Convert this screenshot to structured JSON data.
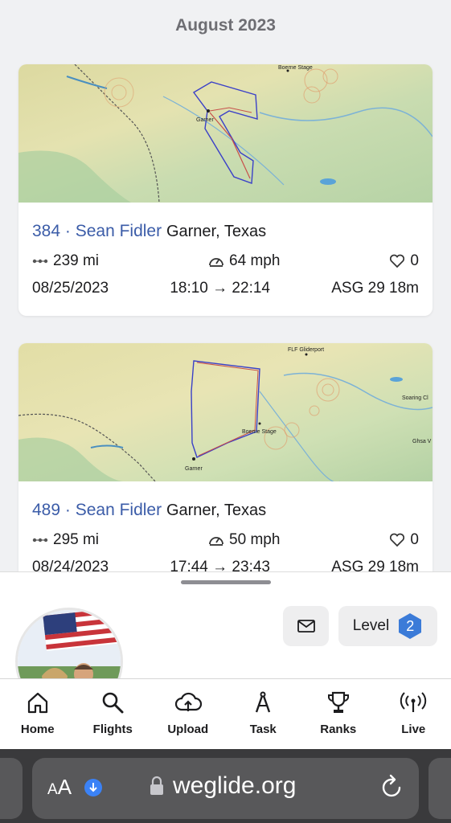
{
  "month_header": "August 2023",
  "flights": [
    {
      "id_pilot": "384 · Sean Fidler",
      "location": "Garner, Texas",
      "distance": "239 mi",
      "speed": "64 mph",
      "likes": "0",
      "date": "08/25/2023",
      "time_range": "18:10 → 22:14",
      "aircraft": "ASG 29 18m",
      "map_labels": {
        "start": "Garner",
        "tp1": "Boerne Stage"
      }
    },
    {
      "id_pilot": "489 · Sean Fidler",
      "location": "Garner, Texas",
      "distance": "295 mi",
      "speed": "50 mph",
      "likes": "0",
      "date": "08/24/2023",
      "time_range": "17:44 → 23:43",
      "aircraft": "ASG 29 18m",
      "map_labels": {
        "start": "Garner",
        "tp1": "Boerne Stage",
        "tp2": "FLF Gliderport",
        "tp3": "Soaring Cl",
        "tp4": "Ghsa V"
      }
    }
  ],
  "profile": {
    "mail_icon": "mail-icon",
    "level_label": "Level",
    "level_value": "2",
    "level_color": "#3b7bd8"
  },
  "tabs": [
    {
      "label": "Home",
      "icon": "home-icon"
    },
    {
      "label": "Flights",
      "icon": "search-icon"
    },
    {
      "label": "Upload",
      "icon": "cloud-upload-icon"
    },
    {
      "label": "Task",
      "icon": "compass-icon"
    },
    {
      "label": "Ranks",
      "icon": "trophy-icon"
    },
    {
      "label": "Live",
      "icon": "broadcast-icon"
    }
  ],
  "browser": {
    "text_size_label": "AA",
    "url": "weglide.org"
  },
  "colors": {
    "link": "#3b5ca8",
    "track_blue": "#3a40c8",
    "track_red": "#c8504a"
  }
}
